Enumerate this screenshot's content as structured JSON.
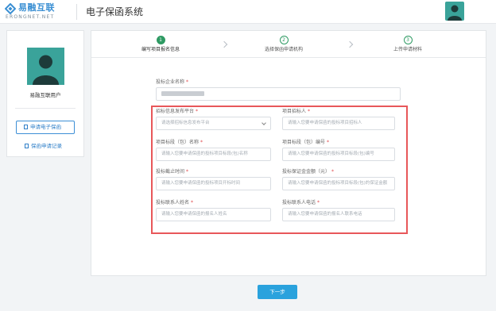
{
  "header": {
    "logo_text": "易融互联",
    "logo_sub": "ERONGNET.NET",
    "system_title": "电子保函系统"
  },
  "sidebar": {
    "user_name": "易融互联用户",
    "apply_button": "申请电子保函",
    "records_link": "保函申请记录"
  },
  "steps": [
    {
      "num": "1",
      "label": "编写项目报名信息",
      "active": true
    },
    {
      "num": "2",
      "label": "选择保函申请机构",
      "active": false
    },
    {
      "num": "3",
      "label": "上传申请材料",
      "active": false
    }
  ],
  "form": {
    "company": {
      "label": "投标企业名称"
    },
    "platform": {
      "label": "招标信息发布平台",
      "placeholder": "请选择招标信息发布平台"
    },
    "tenderee": {
      "label": "项目招标人",
      "placeholder": "请输入您要申请保函的投标项目招标人"
    },
    "section_name": {
      "label": "项目标段（包）名称",
      "placeholder": "请输入您要申请保函的投标项目标段(包)名称"
    },
    "section_no": {
      "label": "项目标段（包）编号",
      "placeholder": "请输入您要申请保函的投标项目标段(包)编号"
    },
    "deadline": {
      "label": "投标截止时间",
      "placeholder": "请输入您要申请保函的投标项目开标时间"
    },
    "amount": {
      "label": "投标保证金金额（元）",
      "placeholder": "请输入您要申请保函的投标项目标段(包)的保证金额"
    },
    "contact_name": {
      "label": "投标联系人姓名",
      "placeholder": "请输入您要申请保函的报名人姓名"
    },
    "contact_phone": {
      "label": "投标联系人电话",
      "placeholder": "请输入您要申请保函的报名人联系电话"
    }
  },
  "next_button": "下一步",
  "colors": {
    "brand": "#3a8fd3",
    "avatar": "#3aa39a",
    "step_active": "#2e9a63",
    "highlight": "#e8575a",
    "primary_button": "#2aa2dd"
  }
}
